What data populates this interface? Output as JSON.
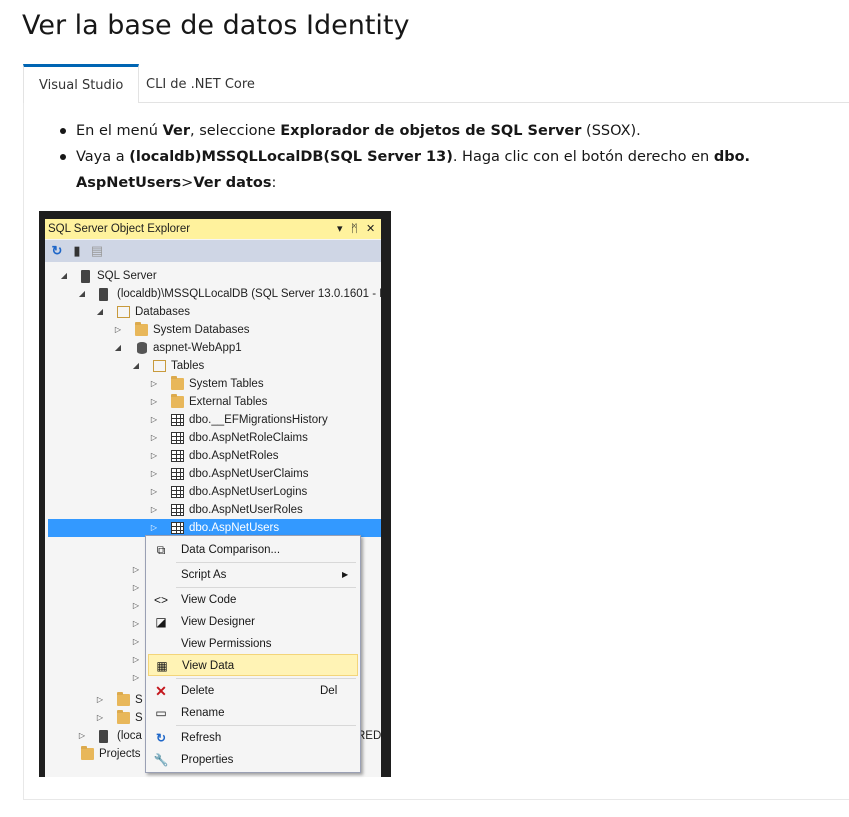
{
  "heading": "Ver la base de datos Identity",
  "tabs": [
    {
      "label": "Visual Studio",
      "active": true
    },
    {
      "label": "CLI de .NET Core",
      "active": false
    }
  ],
  "bullets": {
    "b1_pre": "En el menú ",
    "b1_ver": "Ver",
    "b1_mid": ", seleccione ",
    "b1_sql": "Explorador de objetos de SQL Server",
    "b1_post": " (SSOX).",
    "b2_pre": "Vaya a ",
    "b2_local": "(localdb)MSSQLLocalDB(SQL Server 13)",
    "b2_mid": ". Haga clic con el botón derecho en ",
    "b2_dbo": "dbo. AspNetUsers",
    "b2_gt": ">",
    "b2_ver": "Ver datos",
    "b2_post": ":"
  },
  "ssox": {
    "title": "SQL Server Object Explorer",
    "title_controls": {
      "dropdown": "▾",
      "pin": "ᛗ",
      "close": "✕"
    },
    "toolbar": {
      "refresh_icon": "refresh-icon",
      "add_server_icon": "add-server-icon",
      "filter_icon": "filter-icon"
    },
    "tree": {
      "sql_server": "SQL Server",
      "localdb": "(localdb)\\MSSQLLocalDB (SQL Server 13.0.1601 - F",
      "databases": "Databases",
      "system_databases": "System Databases",
      "aspnet": "aspnet-WebApp1",
      "tables": "Tables",
      "system_tables": "System Tables",
      "external_tables": "External Tables",
      "t1": "dbo.__EFMigrationsHistory",
      "t2": "dbo.AspNetRoleClaims",
      "t3": "dbo.AspNetRoles",
      "t4": "dbo.AspNetUserClaims",
      "t5": "dbo.AspNetUserLogins",
      "t6": "dbo.AspNetUserRoles",
      "t7": "dbo.AspNetUsers",
      "s_a": "S",
      "s_b": "S",
      "local2": "(loca",
      "local2_tail": "REDI",
      "projects": "Projects"
    }
  },
  "context_menu": {
    "data_comparison": "Data Comparison...",
    "script_as": "Script As",
    "view_code": "View Code",
    "view_designer": "View Designer",
    "view_permissions": "View Permissions",
    "view_data": "View Data",
    "delete": "Delete",
    "delete_key": "Del",
    "rename": "Rename",
    "refresh": "Refresh",
    "properties": "Properties",
    "submenu_arrow": "▶"
  }
}
